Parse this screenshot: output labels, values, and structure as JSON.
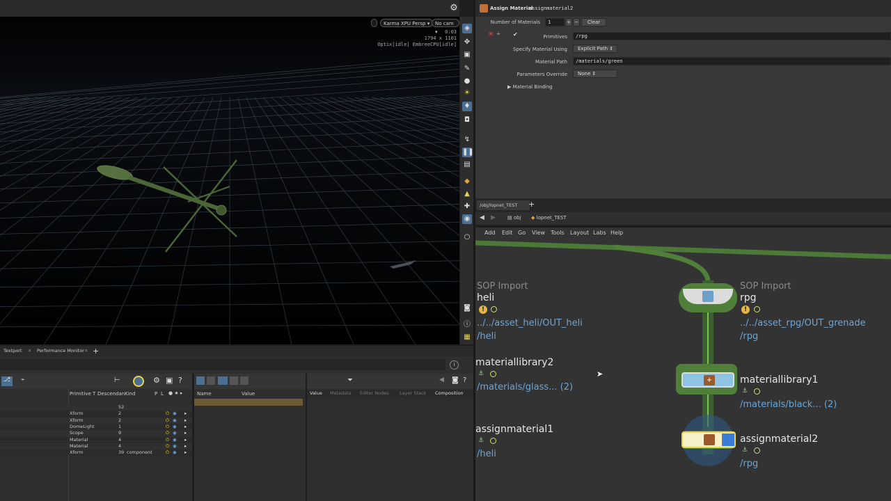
{
  "viewport": {
    "renderer_label": "Karma XPU",
    "camera_mode": "Persp",
    "camera": "No cam",
    "time": "0:03",
    "resolution": "1794 x 1101",
    "engine_status": "Optix[idle] EmbreeCPU[idle]"
  },
  "params": {
    "node_type": "Assign Material",
    "node_name": "assignmaterial2",
    "num_materials_label": "Number of Materials",
    "num_materials_value": "1",
    "clear_label": "Clear",
    "primitives_label": "Primitives",
    "primitives_value": "/rpg",
    "specify_label": "Specify Material Using",
    "specify_value": "Explicit Path",
    "material_path_label": "Material Path",
    "material_path_value": "/materials/green",
    "params_override_label": "Parameters Override",
    "params_override_value": "None",
    "material_binding_label": "Material Binding"
  },
  "network": {
    "tab_label": "/obj/lopnet_TEST",
    "add_tab": "+",
    "path_obj": "obj",
    "path_lopnet": "lopnet_TEST",
    "menu": [
      "Add",
      "Edit",
      "Go",
      "View",
      "Tools",
      "Layout",
      "Labs",
      "Help"
    ],
    "nodes": {
      "heli": {
        "type": "SOP Import",
        "name": "heli",
        "path1": "../../asset_heli/OUT_heli",
        "path2": "/heli"
      },
      "rpg": {
        "type": "SOP Import",
        "name": "rpg",
        "path1": "../../asset_rpg/OUT_grenade",
        "path2": "/rpg"
      },
      "matlib2": {
        "name": "materiallibrary2",
        "path": "/materials/glass... (2)"
      },
      "matlib1": {
        "name": "materiallibrary1",
        "path": "/materials/black... (2)"
      },
      "assign1": {
        "name": "assignmaterial1",
        "path": "/heli"
      },
      "assign2": {
        "name": "assignmaterial2",
        "path": "/rpg"
      }
    }
  },
  "bottom": {
    "tabs": [
      "Textport",
      "Performance Monitor"
    ],
    "add_tab": "+",
    "scene_headers": [
      "Primitive T",
      "Descendan",
      "Kind",
      "P",
      "L"
    ],
    "scene_rows": [
      {
        "type": "",
        "desc": "52",
        "kind": ""
      },
      {
        "type": "Xform",
        "desc": "2",
        "kind": ""
      },
      {
        "type": "Xform",
        "desc": "2",
        "kind": ""
      },
      {
        "type": "DomeLight",
        "desc": "1",
        "kind": ""
      },
      {
        "type": "Scope",
        "desc": "9",
        "kind": ""
      },
      {
        "type": "Material",
        "desc": "4",
        "kind": ""
      },
      {
        "type": "Material",
        "desc": "4",
        "kind": ""
      },
      {
        "type": "Xform",
        "desc": "39",
        "kind": "component"
      }
    ],
    "props_headers": [
      "Name",
      "Value"
    ],
    "value_tabs": [
      "Value",
      "Metadata",
      "Editor Nodes",
      "Layer Stack",
      "Composition"
    ]
  },
  "colors": {
    "wire": "#7fbf5a",
    "selected": "#e8d44a",
    "link": "#6aa6d8",
    "flag": "#cfe36a"
  }
}
